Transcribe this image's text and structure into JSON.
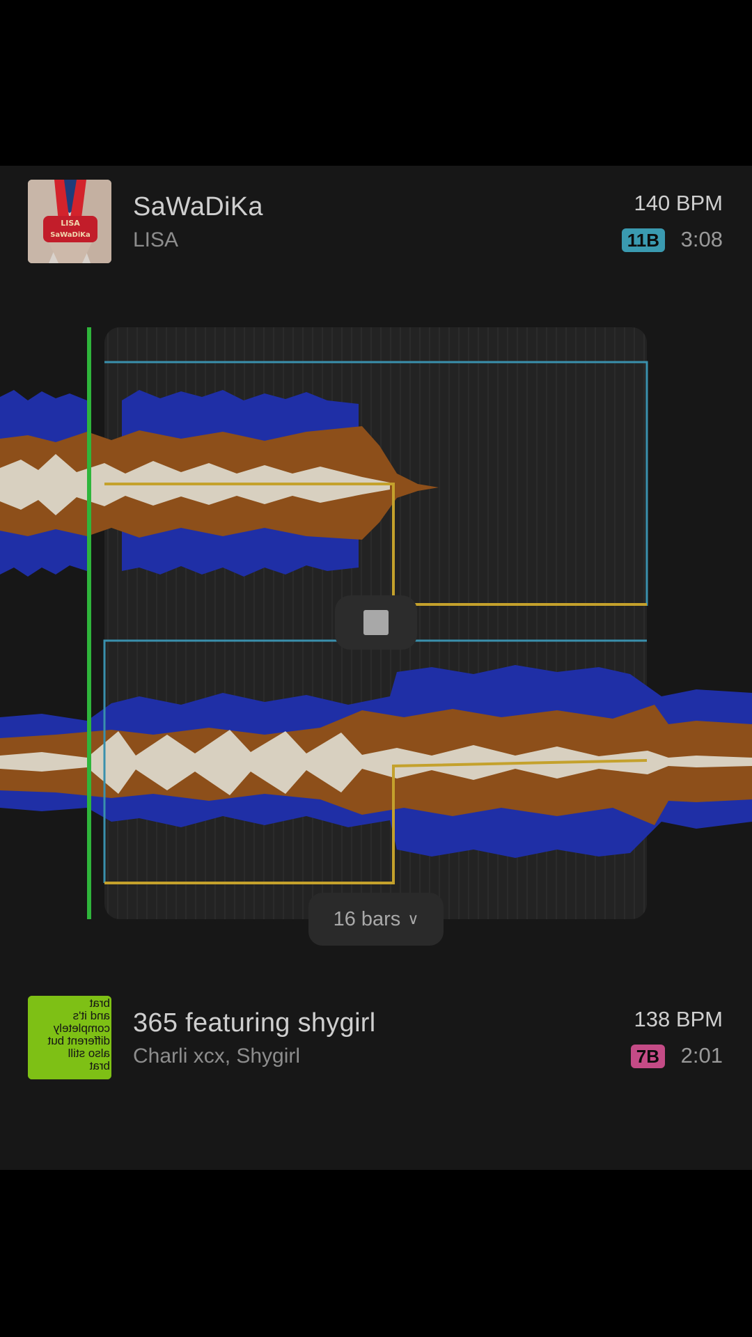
{
  "current_track": {
    "title": "SaWaDiKa",
    "artist": "LISA",
    "bpm": "140 BPM",
    "key": "11B",
    "key_color": "#3a9ab0",
    "duration": "3:08",
    "cover_icon": "album-cover-sawadika"
  },
  "next_track": {
    "title": "365 featuring shygirl",
    "artist": "Charli xcx, Shygirl",
    "bpm": "138 BPM",
    "key": "7B",
    "key_color": "#c44b86",
    "duration": "2:01",
    "cover_icon": "album-cover-brat",
    "cover_text": [
      "brat",
      "and it's",
      "completely",
      "different but",
      "also still",
      "brat"
    ]
  },
  "transition": {
    "length_label": "16 bars",
    "stop_icon": "stop-icon",
    "chevron_icon": "chevron-down-icon"
  },
  "colors": {
    "playhead": "#2fb53b",
    "mix_region": "#3a90ad",
    "volume_curve": "#c4a12c",
    "wave_low": "#1e2fa8",
    "wave_mid": "#8a4e1a",
    "wave_high": "#d9d2c2"
  }
}
